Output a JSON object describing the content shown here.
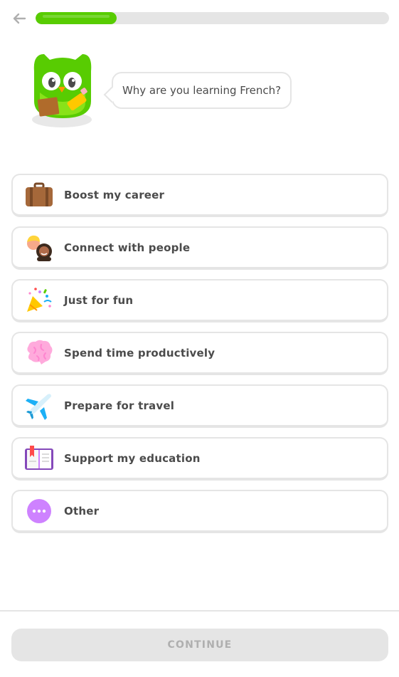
{
  "header": {
    "back_icon": "arrow-left-icon",
    "progress_fraction": 0.23,
    "progress_color": "#58cc02"
  },
  "prompt": {
    "mascot_icon": "owl-mascot-icon",
    "question": "Why are you learning French?"
  },
  "options": [
    {
      "label": "Boost my career",
      "icon": "briefcase-icon"
    },
    {
      "label": "Connect with people",
      "icon": "people-icon"
    },
    {
      "label": "Just for fun",
      "icon": "party-popper-icon"
    },
    {
      "label": "Spend time productively",
      "icon": "brain-icon"
    },
    {
      "label": "Prepare for travel",
      "icon": "airplane-icon"
    },
    {
      "label": "Support my education",
      "icon": "book-icon"
    },
    {
      "label": "Other",
      "icon": "more-dots-icon"
    }
  ],
  "footer": {
    "continue_label": "CONTINUE"
  },
  "colors": {
    "accent": "#58cc02",
    "border": "#e5e5e5",
    "text": "#4b4b4b",
    "disabled_text": "#afafaf"
  }
}
